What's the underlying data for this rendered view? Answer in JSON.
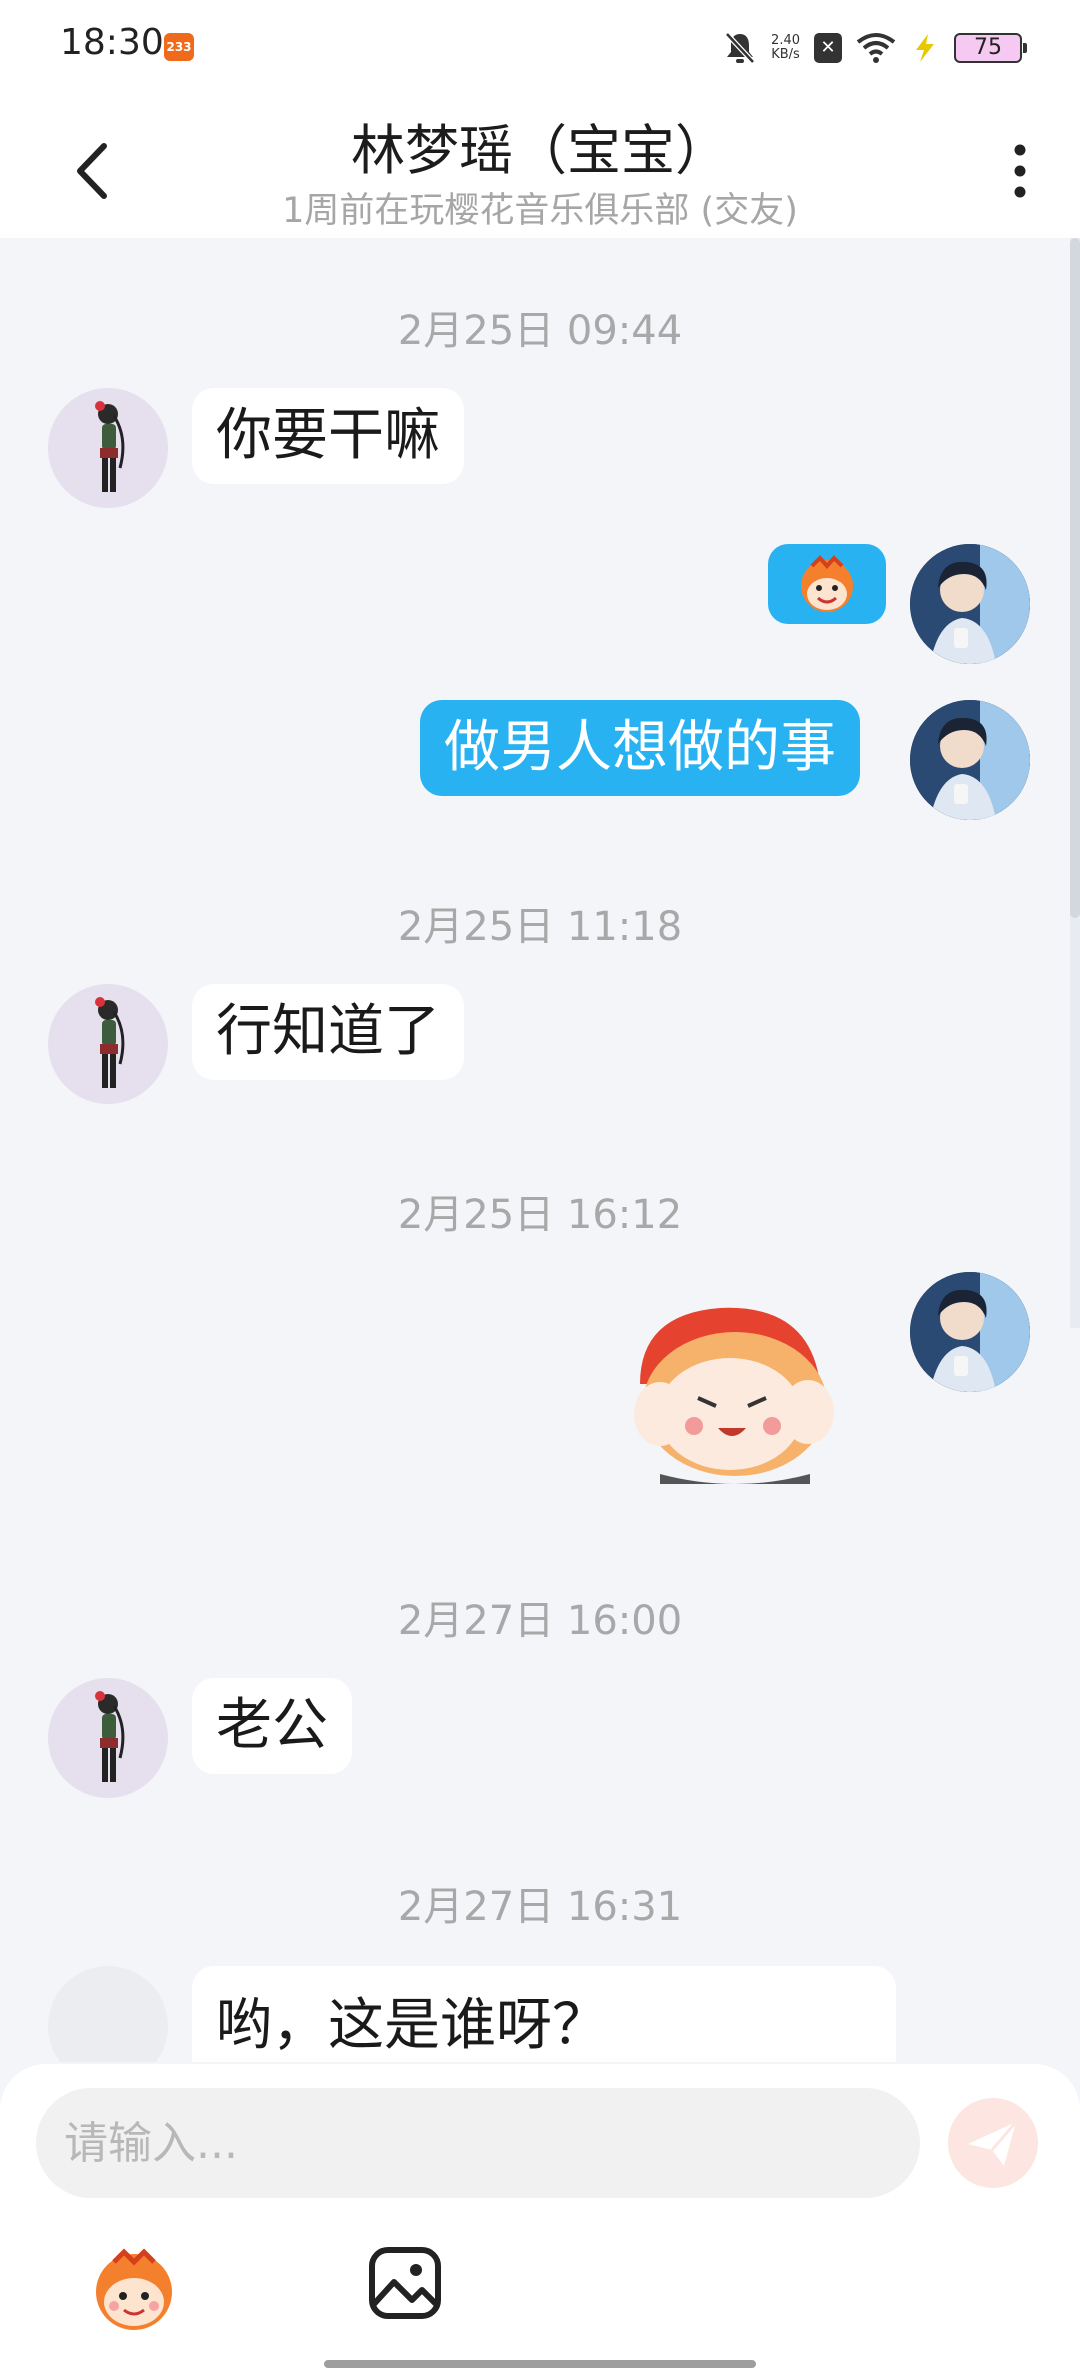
{
  "status_bar": {
    "time": "18:30",
    "app_badge": "233",
    "net_speed_top": "2.40",
    "net_speed_unit": "KB/s",
    "battery": "75"
  },
  "header": {
    "title": "林梦瑶（宝宝）",
    "subtitle": "1周前在玩樱花音乐俱乐部 (交友)"
  },
  "messages": {
    "ts1": "2月25日 09:44",
    "m1": "你要干嘛",
    "m3": "做男人想做的事",
    "ts2": "2月25日 11:18",
    "m4": "行知道了",
    "ts3": "2月25日 16:12",
    "ts4": "2月27日 16:00",
    "m6": "老公",
    "ts5": "2月27日 16:31",
    "m7": "哟，这是谁呀？"
  },
  "input": {
    "placeholder": "请输入..."
  },
  "colors": {
    "accent": "#28b2f2",
    "background": "#f3f5f9",
    "send_button": "#fde5e1"
  }
}
